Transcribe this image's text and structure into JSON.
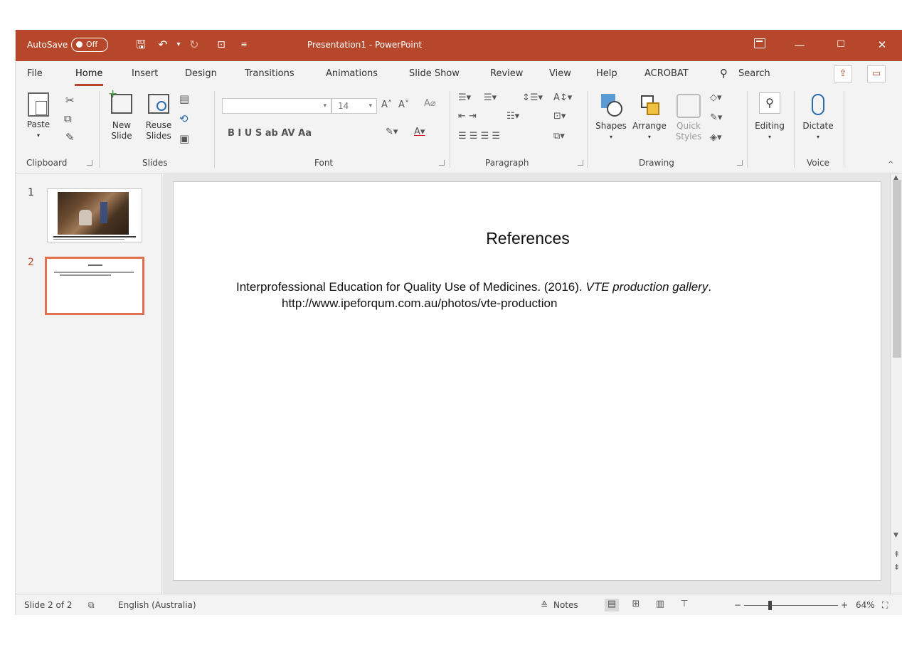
{
  "titlebar": {
    "autosave_label": "AutoSave",
    "autosave_state": "Off",
    "title": "Presentation1  -  PowerPoint",
    "accent": "#b7472a"
  },
  "tabs": [
    {
      "label": "File"
    },
    {
      "label": "Home"
    },
    {
      "label": "Insert"
    },
    {
      "label": "Design"
    },
    {
      "label": "Transitions"
    },
    {
      "label": "Animations"
    },
    {
      "label": "Slide Show"
    },
    {
      "label": "Review"
    },
    {
      "label": "View"
    },
    {
      "label": "Help"
    },
    {
      "label": "ACROBAT"
    },
    {
      "label": "Search"
    }
  ],
  "ribbon": {
    "clipboard": {
      "paste": "Paste",
      "label": "Clipboard"
    },
    "slides": {
      "new_slide_1": "New",
      "new_slide_2": "Slide",
      "reuse_1": "Reuse",
      "reuse_2": "Slides",
      "label": "Slides"
    },
    "font": {
      "size": "14",
      "label": "Font",
      "font_name": "",
      "format_row": "B   I   U   S   ab   AV   Aa"
    },
    "paragraph": {
      "label": "Paragraph"
    },
    "drawing": {
      "shapes": "Shapes",
      "arrange": "Arrange",
      "quick_1": "Quick",
      "quick_2": "Styles",
      "label": "Drawing"
    },
    "editing": {
      "label": "Editing"
    },
    "voice": {
      "dictate": "Dictate",
      "label": "Voice"
    }
  },
  "thumbnails": [
    {
      "number": "1"
    },
    {
      "number": "2"
    }
  ],
  "slide": {
    "title": "References",
    "ref_text": "Interprofessional Education for Quality Use of Medicines. (2016). ",
    "ref_italic": "VTE production gallery",
    "ref_end": ".",
    "ref_url": "http://www.ipeforqum.com.au/photos/vte-production"
  },
  "status": {
    "slide_count": "Slide 2 of 2",
    "language": "English (Australia)",
    "notes": "Notes",
    "zoom": "64%"
  }
}
